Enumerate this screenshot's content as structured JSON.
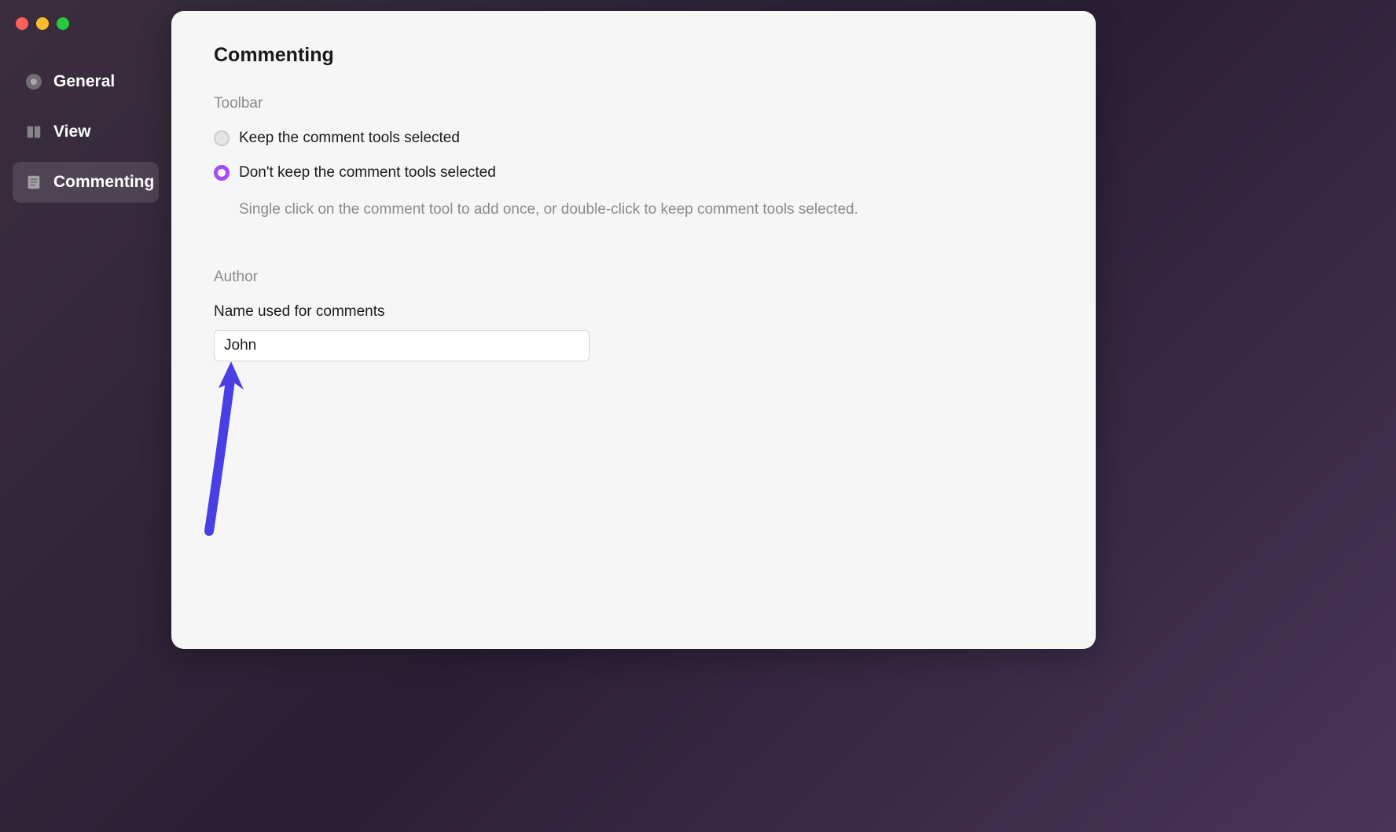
{
  "sidebar": {
    "items": [
      {
        "label": "General"
      },
      {
        "label": "View"
      },
      {
        "label": "Commenting"
      }
    ]
  },
  "main": {
    "title": "Commenting",
    "sections": {
      "toolbar": {
        "heading": "Toolbar",
        "option_keep": "Keep the comment tools selected",
        "option_dont_keep": "Don't keep the comment tools selected",
        "description": "Single click on the comment tool to add once, or double-click to keep comment tools selected."
      },
      "author": {
        "heading": "Author",
        "field_label": "Name used for comments",
        "name_value": "John"
      }
    }
  }
}
